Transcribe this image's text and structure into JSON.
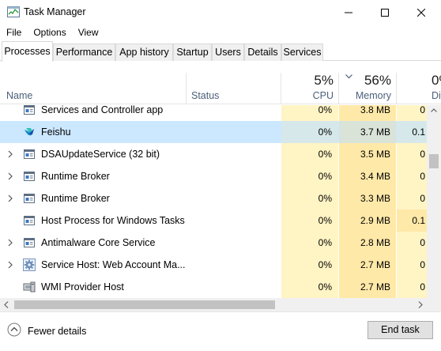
{
  "window": {
    "title": "Task Manager"
  },
  "menu": [
    "File",
    "Options",
    "View"
  ],
  "tabs": [
    "Processes",
    "Performance",
    "App history",
    "Startup",
    "Users",
    "Details",
    "Services"
  ],
  "active_tab": "Processes",
  "columns": {
    "name": "Name",
    "status": "Status",
    "cpu": {
      "label": "CPU",
      "pct": "5%"
    },
    "memory": {
      "label": "Memory",
      "pct": "56%",
      "sorted": true
    },
    "disk": {
      "label": "Di",
      "pct": "0%"
    }
  },
  "processes": [
    {
      "name": "Services and Controller app",
      "cpu": "0%",
      "memory": "3.8 MB",
      "disk": "0",
      "expandable": false,
      "icon": "app-window-icon",
      "selected": false
    },
    {
      "name": "Feishu",
      "cpu": "0%",
      "memory": "3.7 MB",
      "disk": "0.1",
      "expandable": false,
      "icon": "feishu-icon",
      "selected": true
    },
    {
      "name": "DSAUpdateService (32 bit)",
      "cpu": "0%",
      "memory": "3.5 MB",
      "disk": "0",
      "expandable": true,
      "icon": "app-window-icon",
      "selected": false
    },
    {
      "name": "Runtime Broker",
      "cpu": "0%",
      "memory": "3.4 MB",
      "disk": "0",
      "expandable": true,
      "icon": "app-window-icon",
      "selected": false
    },
    {
      "name": "Runtime Broker",
      "cpu": "0%",
      "memory": "3.3 MB",
      "disk": "0",
      "expandable": true,
      "icon": "app-window-icon",
      "selected": false
    },
    {
      "name": "Host Process for Windows Tasks",
      "cpu": "0%",
      "memory": "2.9 MB",
      "disk": "0.1",
      "expandable": false,
      "icon": "app-window-icon",
      "selected": false
    },
    {
      "name": "Antimalware Core Service",
      "cpu": "0%",
      "memory": "2.8 MB",
      "disk": "0",
      "expandable": true,
      "icon": "app-window-icon",
      "selected": false
    },
    {
      "name": "Service Host: Web Account Ma...",
      "cpu": "0%",
      "memory": "2.7 MB",
      "disk": "0",
      "expandable": true,
      "icon": "gear-icon",
      "selected": false
    },
    {
      "name": "WMI Provider Host",
      "cpu": "0%",
      "memory": "2.7 MB",
      "disk": "0",
      "expandable": false,
      "icon": "wmi-icon",
      "selected": false
    }
  ],
  "footer": {
    "fewer_details": "Fewer details",
    "end_task": "End task"
  },
  "colors": {
    "cpu_col": "#fff4c4",
    "mem_col": "#ffe9a8",
    "selected": "#cce8ff",
    "header_text": "#4c607a"
  }
}
